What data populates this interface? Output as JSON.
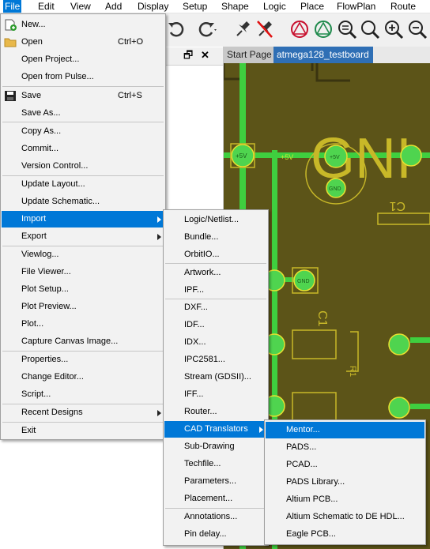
{
  "menubar": {
    "items": [
      "File",
      "Edit",
      "View",
      "Add",
      "Display",
      "Setup",
      "Shape",
      "Logic",
      "Place",
      "FlowPlan",
      "Route"
    ],
    "active": "File"
  },
  "toolbar": {
    "icons": [
      "undo-icon",
      "redo-icon",
      "pin-icon",
      "unpin-icon",
      "ratsnest-icon",
      "ratsnest-all-icon",
      "zoom-fit-icon",
      "zoom-window-icon",
      "zoom-in-icon",
      "zoom-out-icon"
    ]
  },
  "panel": {
    "float_button": "🗗",
    "close_button": "✕"
  },
  "tabs": {
    "start_page": "Start Page",
    "active_design": "atmega128_testboard"
  },
  "file_menu": {
    "items": [
      {
        "label": "New...",
        "shortcut": ""
      },
      {
        "label": "Open",
        "shortcut": "Ctrl+O"
      },
      {
        "label": "Open Project...",
        "shortcut": ""
      },
      {
        "label": "Open from Pulse...",
        "shortcut": ""
      },
      {
        "label": "Save",
        "shortcut": "Ctrl+S"
      },
      {
        "label": "Save As...",
        "shortcut": ""
      },
      {
        "label": "Copy As...",
        "shortcut": ""
      },
      {
        "label": "Commit...",
        "shortcut": ""
      },
      {
        "label": "Version Control...",
        "shortcut": ""
      },
      {
        "label": "Update Layout...",
        "shortcut": ""
      },
      {
        "label": "Update Schematic...",
        "shortcut": ""
      },
      {
        "label": "Import",
        "shortcut": ""
      },
      {
        "label": "Export",
        "shortcut": ""
      },
      {
        "label": "Viewlog...",
        "shortcut": ""
      },
      {
        "label": "File Viewer...",
        "shortcut": ""
      },
      {
        "label": "Plot Setup...",
        "shortcut": ""
      },
      {
        "label": "Plot Preview...",
        "shortcut": ""
      },
      {
        "label": "Plot...",
        "shortcut": ""
      },
      {
        "label": "Capture Canvas Image...",
        "shortcut": ""
      },
      {
        "label": "Properties...",
        "shortcut": ""
      },
      {
        "label": "Change Editor...",
        "shortcut": ""
      },
      {
        "label": "Script...",
        "shortcut": ""
      },
      {
        "label": "Recent Designs",
        "shortcut": ""
      },
      {
        "label": "Exit",
        "shortcut": ""
      }
    ]
  },
  "import_menu": {
    "items": [
      {
        "label": "Logic/Netlist..."
      },
      {
        "label": "Bundle..."
      },
      {
        "label": "OrbitIO..."
      },
      {
        "label": "Artwork..."
      },
      {
        "label": "IPF..."
      },
      {
        "label": "DXF..."
      },
      {
        "label": "IDF..."
      },
      {
        "label": "IDX..."
      },
      {
        "label": "IPC2581..."
      },
      {
        "label": "Stream (GDSII)..."
      },
      {
        "label": "IFF..."
      },
      {
        "label": "Router..."
      },
      {
        "label": "CAD Translators"
      },
      {
        "label": "Sub-Drawing"
      },
      {
        "label": "Techfile..."
      },
      {
        "label": "Parameters..."
      },
      {
        "label": "Placement..."
      },
      {
        "label": "Annotations..."
      },
      {
        "label": "Pin delay..."
      }
    ]
  },
  "cad_menu": {
    "items": [
      {
        "label": "Mentor..."
      },
      {
        "label": "PADS..."
      },
      {
        "label": "PCAD..."
      },
      {
        "label": "PADS Library..."
      },
      {
        "label": "Altium PCB..."
      },
      {
        "label": "Altium Schematic to DE HDL..."
      },
      {
        "label": "Eagle PCB..."
      }
    ]
  },
  "canvas_labels": {
    "gnd_big": "GNI",
    "plus5v": "+5V",
    "gnd": "GND",
    "c1": "C1",
    "r1": "R1",
    "c1_rot": "C1"
  },
  "colors": {
    "board": "#5c5418",
    "trace": "#3fcf3f",
    "silk": "#c8b828",
    "pad": "#4fd44f",
    "highlight": "#0078d7"
  }
}
